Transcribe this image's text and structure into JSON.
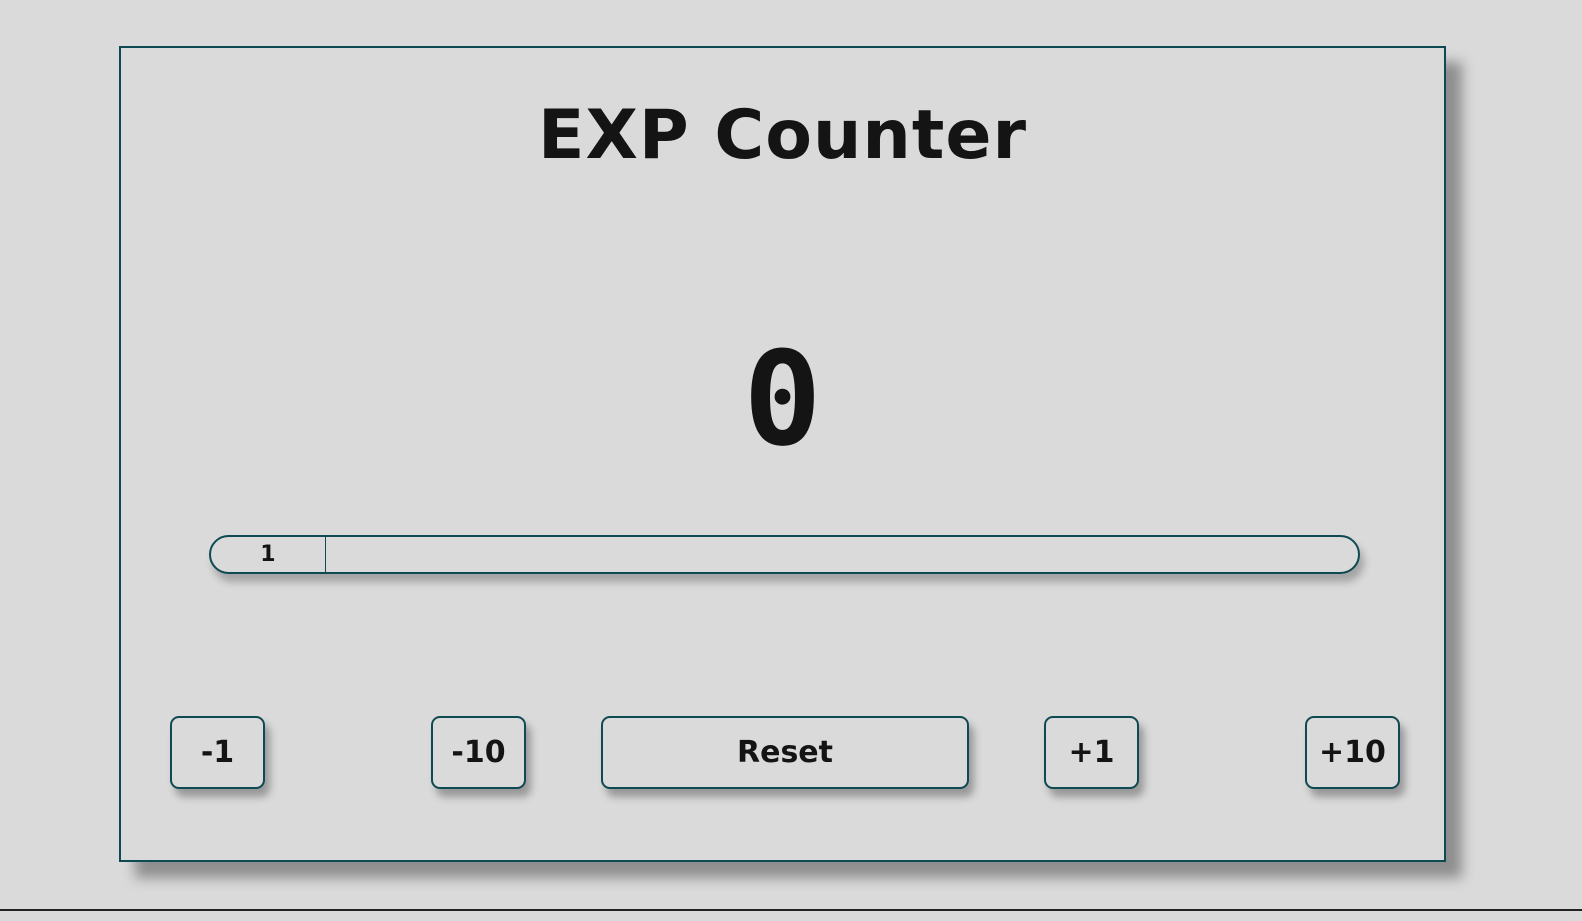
{
  "app": {
    "title": "EXP Counter"
  },
  "counter": {
    "value": "0"
  },
  "progress": {
    "label": "1",
    "fraction": 0.1
  },
  "buttons": {
    "minus1": "-1",
    "minus10": "-10",
    "reset": "Reset",
    "plus1": "+1",
    "plus10": "+10"
  },
  "colors": {
    "background": "#dadada",
    "border": "#0f4a52",
    "text": "#141414"
  }
}
